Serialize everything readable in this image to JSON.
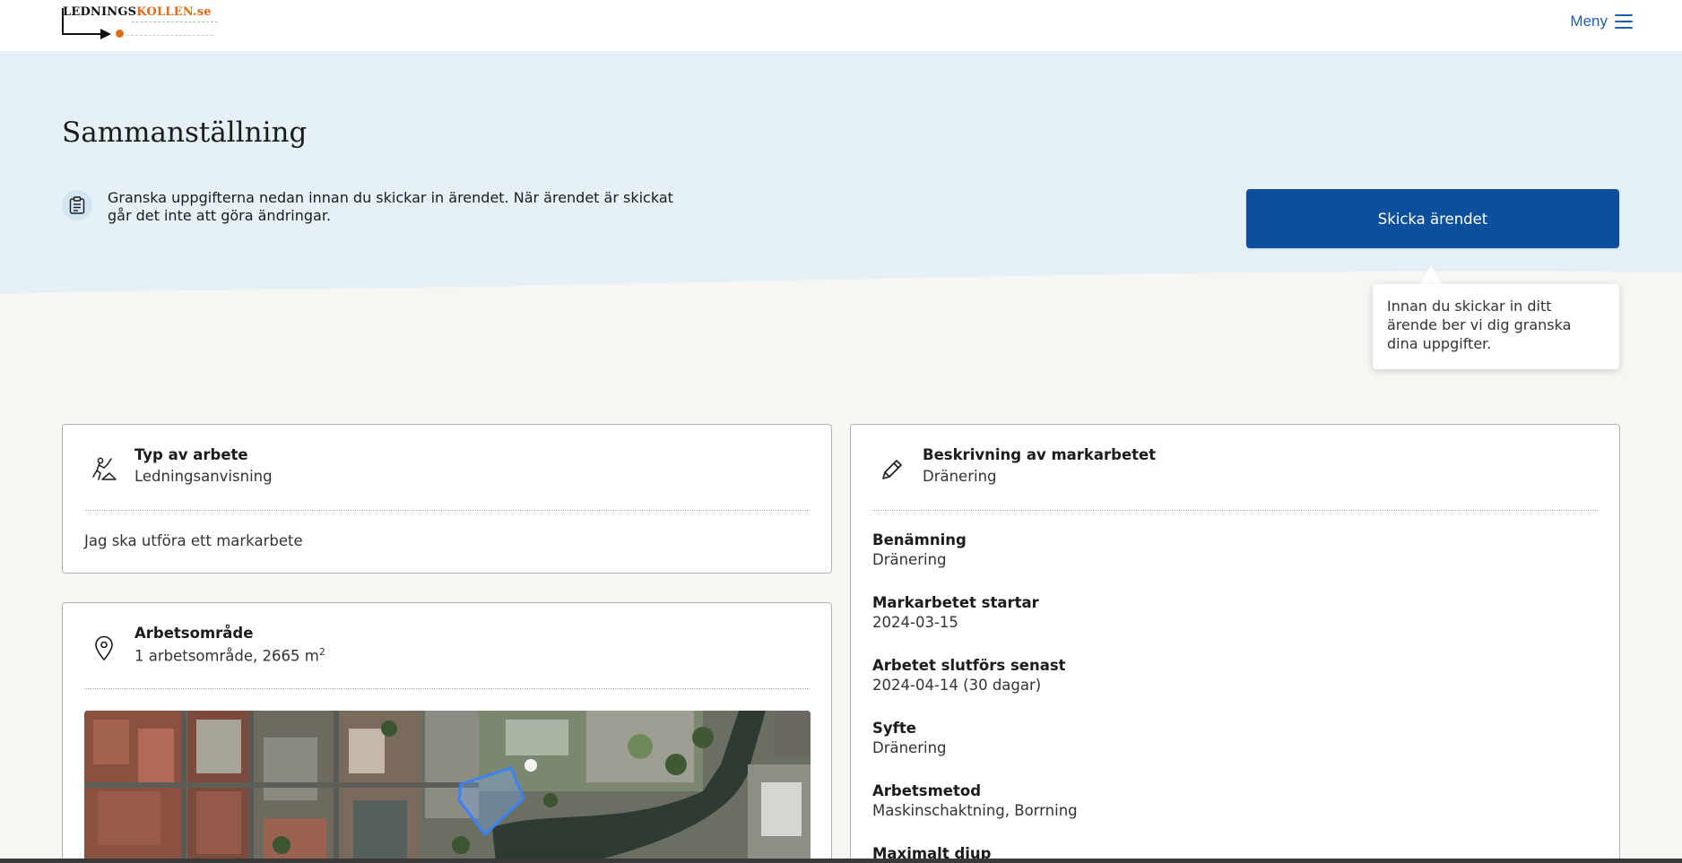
{
  "header": {
    "logo_text_dark": "LEDNINGS",
    "logo_text_accent": "KOLLEN.se",
    "menu_label": "Meny"
  },
  "hero": {
    "title": "Sammanställning",
    "info_text": "Granska uppgifterna nedan innan du skickar in ärendet. När ärendet är skickat går det inte att göra ändringar.",
    "send_button_label": "Skicka ärendet",
    "tooltip_text": "Innan du skickar in ditt ärende ber vi dig granska dina uppgifter."
  },
  "work_type_card": {
    "title": "Typ av arbete",
    "value": "Ledningsanvisning",
    "body": "Jag ska utföra ett markarbete"
  },
  "work_area_card": {
    "title": "Arbetsområde",
    "value": "1 arbetsområde, 2665 m",
    "unit_superscript": "2"
  },
  "description_card": {
    "title": "Beskrivning av markarbetet",
    "value": "Dränering",
    "details": [
      {
        "label": "Benämning",
        "value": "Dränering"
      },
      {
        "label": "Markarbetet startar",
        "value": "2024-03-15"
      },
      {
        "label": "Arbetet slutförs senast",
        "value": "2024-04-14 (30 dagar)"
      },
      {
        "label": "Syfte",
        "value": "Dränering"
      },
      {
        "label": "Arbetsmetod",
        "value": "Maskinschaktning, Borrning"
      },
      {
        "label": "Maximalt djup",
        "value": ""
      }
    ]
  },
  "colors": {
    "primary": "#0c4f9c",
    "link": "#1f5fae",
    "hero_bg": "#e6f1f7",
    "page_bg": "#f8f6f3",
    "logo_accent": "#e36a1a",
    "map_area_outline": "#3b82f6"
  },
  "icons": {
    "info": "clipboard-icon",
    "work_type": "digging-worker-icon",
    "work_area": "location-pin-icon",
    "description": "pencil-icon",
    "menu": "hamburger-icon"
  }
}
